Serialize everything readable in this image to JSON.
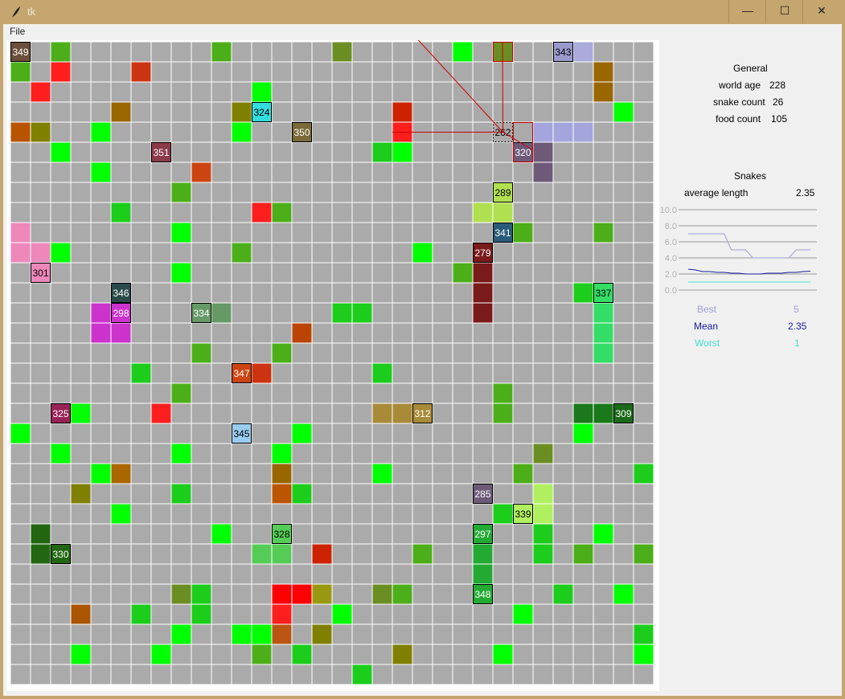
{
  "window": {
    "title": "tk",
    "minimize_glyph": "—",
    "maximize_glyph": "☐",
    "close_glyph": "✕"
  },
  "menu": {
    "file": "File"
  },
  "general": {
    "heading": "General",
    "world_age_label": "world age",
    "world_age": "228",
    "snake_count_label": "snake count",
    "snake_count": "26",
    "food_count_label": "food count",
    "food_count": "105"
  },
  "snakes": {
    "heading": "Snakes",
    "avg_length_label": "average length",
    "avg_length": "2.35",
    "best_label": "Best",
    "best_value": "5",
    "mean_label": "Mean",
    "mean_value": "2.35",
    "worst_label": "Worst",
    "worst_value": "1"
  },
  "colors": {
    "best": "#a09ed6",
    "mean": "#1a1aa0",
    "worst": "#40e0d0",
    "board_bg": "#aaaaaa",
    "grid": "#ffffff"
  },
  "chart_data": {
    "type": "line",
    "ylim": [
      0,
      10
    ],
    "yticks": [
      "10.0",
      "8.0",
      "6.0",
      "4.0",
      "2.0",
      "0.0"
    ],
    "series": [
      {
        "name": "Best",
        "values": [
          7,
          7,
          7,
          7,
          7,
          7,
          5,
          5,
          5,
          4,
          4,
          4,
          4,
          4,
          4,
          5,
          5,
          5
        ]
      },
      {
        "name": "Mean",
        "values": [
          2.6,
          2.5,
          2.3,
          2.3,
          2.2,
          2.2,
          2.1,
          2.1,
          2.0,
          2.0,
          2.0,
          2.1,
          2.1,
          2.1,
          2.2,
          2.2,
          2.3,
          2.35
        ]
      },
      {
        "name": "Worst",
        "values": [
          1,
          1,
          1,
          1,
          1,
          1,
          1,
          1,
          1,
          1,
          1,
          1,
          1,
          1,
          1,
          1,
          1,
          1
        ]
      }
    ]
  },
  "grid": {
    "cols": 32,
    "rows": 32
  },
  "cells": [
    [
      0,
      0,
      "#6b4f3a"
    ],
    [
      2,
      0,
      "#4caf1a"
    ],
    [
      10,
      0,
      "#4caf1a"
    ],
    [
      0,
      1,
      "#4caf1a"
    ],
    [
      2,
      1,
      "#ff1e1e"
    ],
    [
      6,
      1,
      "#cc3311"
    ],
    [
      1,
      2,
      "#ff1e1e"
    ],
    [
      12,
      2,
      "#00ff00"
    ],
    [
      16,
      0,
      "#6b8e23"
    ],
    [
      22,
      0,
      "#00ff00"
    ],
    [
      27,
      0,
      "#9999cc"
    ],
    [
      28,
      0,
      "#aaaadd"
    ],
    [
      29,
      1,
      "#996600"
    ],
    [
      29,
      2,
      "#996600"
    ],
    [
      5,
      3,
      "#996600"
    ],
    [
      11,
      3,
      "#808000"
    ],
    [
      19,
      3,
      "#cc2200"
    ],
    [
      30,
      3,
      "#00ff00"
    ],
    [
      0,
      4,
      "#b85400"
    ],
    [
      1,
      4,
      "#808000"
    ],
    [
      4,
      4,
      "#00ff00"
    ],
    [
      11,
      4,
      "#00ff00"
    ],
    [
      19,
      4,
      "#ff1e1e"
    ],
    [
      26,
      4,
      "#a5a5dd"
    ],
    [
      27,
      4,
      "#a5a5dd"
    ],
    [
      28,
      4,
      "#a5a5dd"
    ],
    [
      2,
      5,
      "#00ff00"
    ],
    [
      18,
      5,
      "#1ccd1c"
    ],
    [
      19,
      5,
      "#00ff00"
    ],
    [
      25,
      5,
      "#6e5a78"
    ],
    [
      26,
      5,
      "#6e5a78"
    ],
    [
      4,
      6,
      "#00ff00"
    ],
    [
      9,
      6,
      "#cc4411"
    ],
    [
      26,
      6,
      "#6e5a78"
    ],
    [
      8,
      7,
      "#4caf1a"
    ],
    [
      5,
      8,
      "#1ccd1c"
    ],
    [
      12,
      8,
      "#ff1e1e"
    ],
    [
      13,
      8,
      "#4caf1a"
    ],
    [
      23,
      8,
      "#b0e050"
    ],
    [
      24,
      8,
      "#b0e050"
    ],
    [
      0,
      9,
      "#ee88bb"
    ],
    [
      8,
      9,
      "#00ff00"
    ],
    [
      25,
      9,
      "#4caf1a"
    ],
    [
      29,
      9,
      "#4caf1a"
    ],
    [
      0,
      10,
      "#ee88bb"
    ],
    [
      1,
      10,
      "#ee88bb"
    ],
    [
      2,
      10,
      "#00ff00"
    ],
    [
      11,
      10,
      "#4caf1a"
    ],
    [
      20,
      10,
      "#00ff00"
    ],
    [
      8,
      11,
      "#00ff00"
    ],
    [
      22,
      11,
      "#4caf1a"
    ],
    [
      23,
      11,
      "#7a1a1a"
    ],
    [
      23,
      12,
      "#7a1a1a"
    ],
    [
      28,
      12,
      "#1ccd1c"
    ],
    [
      4,
      13,
      "#cc33cc"
    ],
    [
      9,
      13,
      "#669966"
    ],
    [
      10,
      13,
      "#669966"
    ],
    [
      16,
      13,
      "#1ccd1c"
    ],
    [
      17,
      13,
      "#1ccd1c"
    ],
    [
      23,
      13,
      "#7a1a1a"
    ],
    [
      4,
      14,
      "#cc33cc"
    ],
    [
      5,
      14,
      "#cc33cc"
    ],
    [
      14,
      14,
      "#bb4400"
    ],
    [
      29,
      14,
      "#33dd66"
    ],
    [
      29,
      13,
      "#33dd66"
    ],
    [
      9,
      15,
      "#4caf1a"
    ],
    [
      13,
      15,
      "#4caf1a"
    ],
    [
      29,
      15,
      "#33dd66"
    ],
    [
      6,
      16,
      "#1ccd1c"
    ],
    [
      12,
      16,
      "#cc3311"
    ],
    [
      18,
      16,
      "#1ccd1c"
    ],
    [
      8,
      17,
      "#4caf1a"
    ],
    [
      24,
      17,
      "#4caf1a"
    ],
    [
      3,
      18,
      "#00ff00"
    ],
    [
      7,
      18,
      "#ff1e1e"
    ],
    [
      18,
      18,
      "#a88a38"
    ],
    [
      19,
      18,
      "#a88a38"
    ],
    [
      24,
      18,
      "#4caf1a"
    ],
    [
      28,
      18,
      "#1a7a1a"
    ],
    [
      29,
      18,
      "#1a7a1a"
    ],
    [
      0,
      19,
      "#00ff00"
    ],
    [
      14,
      19,
      "#00ff00"
    ],
    [
      28,
      19,
      "#00ff00"
    ],
    [
      2,
      20,
      "#00ff00"
    ],
    [
      8,
      20,
      "#00ff00"
    ],
    [
      13,
      20,
      "#00ff00"
    ],
    [
      26,
      20,
      "#6b8e23"
    ],
    [
      4,
      21,
      "#00ff00"
    ],
    [
      5,
      21,
      "#aa6600"
    ],
    [
      13,
      21,
      "#996600"
    ],
    [
      18,
      21,
      "#00ff00"
    ],
    [
      25,
      21,
      "#4caf1a"
    ],
    [
      31,
      21,
      "#1ccd1c"
    ],
    [
      3,
      22,
      "#808000"
    ],
    [
      8,
      22,
      "#1ccd1c"
    ],
    [
      13,
      22,
      "#bb5500"
    ],
    [
      14,
      22,
      "#1ccd1c"
    ],
    [
      26,
      22,
      "#b0f060"
    ],
    [
      5,
      23,
      "#00ff00"
    ],
    [
      24,
      23,
      "#1ccd1c"
    ],
    [
      26,
      23,
      "#b0f060"
    ],
    [
      1,
      24,
      "#226611"
    ],
    [
      10,
      24,
      "#00ff00"
    ],
    [
      26,
      24,
      "#1ccd1c"
    ],
    [
      29,
      24,
      "#00ff00"
    ],
    [
      1,
      25,
      "#226611"
    ],
    [
      12,
      25,
      "#55cc55"
    ],
    [
      13,
      25,
      "#55cc55"
    ],
    [
      15,
      25,
      "#cc2200"
    ],
    [
      20,
      25,
      "#4caf1a"
    ],
    [
      26,
      25,
      "#1ccd1c"
    ],
    [
      28,
      25,
      "#4caf1a"
    ],
    [
      31,
      25,
      "#4caf1a"
    ],
    [
      23,
      26,
      "#22aa33"
    ],
    [
      23,
      25,
      "#22aa33"
    ],
    [
      8,
      27,
      "#6b8e23"
    ],
    [
      9,
      27,
      "#1ccd1c"
    ],
    [
      13,
      27,
      "#ff0000"
    ],
    [
      14,
      27,
      "#ff0000"
    ],
    [
      15,
      27,
      "#999911"
    ],
    [
      18,
      27,
      "#6b8e23"
    ],
    [
      19,
      27,
      "#4caf1a"
    ],
    [
      27,
      27,
      "#1ccd1c"
    ],
    [
      30,
      27,
      "#00ff00"
    ],
    [
      3,
      28,
      "#aa5500"
    ],
    [
      6,
      28,
      "#1ccd1c"
    ],
    [
      9,
      28,
      "#1ccd1c"
    ],
    [
      13,
      28,
      "#ff1e1e"
    ],
    [
      16,
      28,
      "#00ff00"
    ],
    [
      25,
      28,
      "#00ff00"
    ],
    [
      8,
      29,
      "#00ff00"
    ],
    [
      11,
      29,
      "#00ff00"
    ],
    [
      12,
      29,
      "#00ff00"
    ],
    [
      13,
      29,
      "#bb5511"
    ],
    [
      15,
      29,
      "#808000"
    ],
    [
      31,
      29,
      "#1ccd1c"
    ],
    [
      3,
      30,
      "#00ff00"
    ],
    [
      7,
      30,
      "#00ff00"
    ],
    [
      12,
      30,
      "#4caf1a"
    ],
    [
      14,
      30,
      "#1ccd1c"
    ],
    [
      19,
      30,
      "#808000"
    ],
    [
      24,
      30,
      "#00ff00"
    ],
    [
      31,
      30,
      "#00ff00"
    ],
    [
      17,
      31,
      "#1ccd1c"
    ],
    [
      23,
      22,
      "#6e5a78"
    ],
    [
      23,
      27,
      "#22aa33"
    ],
    [
      24,
      0,
      "#6b8e23"
    ]
  ],
  "heads": [
    [
      0,
      0,
      "349",
      "#6b4f3a"
    ],
    [
      27,
      0,
      "343",
      "#9999cc"
    ],
    [
      12,
      3,
      "324",
      "#33dddd"
    ],
    [
      14,
      4,
      "350",
      "#7a6a3a"
    ],
    [
      7,
      5,
      "351",
      "#8b3a4a"
    ],
    [
      25,
      5,
      "320",
      "#6e5a78"
    ],
    [
      24,
      7,
      "289",
      "#b0e050"
    ],
    [
      24,
      9,
      "341",
      "#2a5a7a"
    ],
    [
      23,
      10,
      "279",
      "#7a1a1a"
    ],
    [
      1,
      11,
      "301",
      "#ee88bb"
    ],
    [
      5,
      12,
      "346",
      "#2a4a4a"
    ],
    [
      5,
      13,
      "298",
      "#cc33cc"
    ],
    [
      9,
      13,
      "334",
      "#669966"
    ],
    [
      29,
      12,
      "337",
      "#33dd66"
    ],
    [
      11,
      16,
      "347",
      "#cc4411"
    ],
    [
      2,
      18,
      "325",
      "#992255"
    ],
    [
      20,
      18,
      "312",
      "#a88a38"
    ],
    [
      30,
      18,
      "309",
      "#1a6a1a"
    ],
    [
      11,
      19,
      "345",
      "#99ccee"
    ],
    [
      23,
      22,
      "285",
      "#6e5a78"
    ],
    [
      25,
      23,
      "339",
      "#b0f060"
    ],
    [
      13,
      24,
      "328",
      "#55cc55"
    ],
    [
      23,
      24,
      "297",
      "#22aa33"
    ],
    [
      2,
      25,
      "330",
      "#226611"
    ],
    [
      23,
      27,
      "348",
      "#22aa33"
    ],
    [
      24,
      4,
      "262",
      "#aaaaaa"
    ]
  ]
}
